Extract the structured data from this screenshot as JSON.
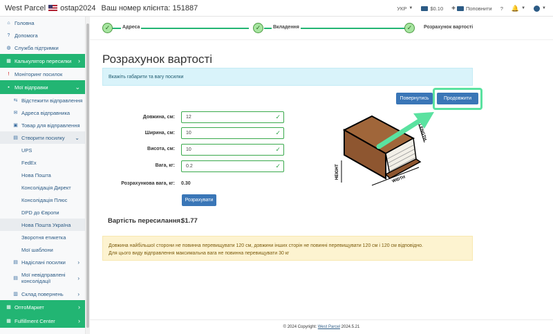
{
  "header": {
    "brand": "West Parcel",
    "username": "ostap2024",
    "client_number": "Ваш номер клієнта: 151887",
    "language": "УКР",
    "balance": "$0.10",
    "topup": "Поповнити",
    "help": "?"
  },
  "sidebar": {
    "home": "Головна",
    "help": "Допомога",
    "support": "Служба підтримки",
    "calculator": "Калькулятор пересилки",
    "monitoring": "Моніторинг посилок",
    "my_shipments": "Мої відправки",
    "track": "Відстежити відправлення",
    "sender_address": "Адреса відправника",
    "goods": "Товар для відправлення",
    "create_parcel": "Створити посилку",
    "carriers": [
      "UPS",
      "FedEx",
      "Нова Пошта",
      "Консолідація Директ",
      "Консолідація Плюс",
      "DPD до Європи",
      "Нова Пошта Україна",
      "Зворотня етикетка",
      "Мої шаблони"
    ],
    "sent": "Надіслані посилки",
    "unsent": "Мої невідправлені консолідації",
    "returns": "Склад повернень",
    "optomarket": "ОптоМаркет",
    "fulfillment": "Fulfillment Center"
  },
  "stepper": {
    "step1": "Адреса",
    "step2": "Вкладення",
    "step3": "Розрахунок вартості"
  },
  "page": {
    "title": "Розрахунок вартості",
    "info": "Вкажіть габарити та вагу посилки",
    "back_button": "Повернутись",
    "continue_button": "Продовжити",
    "length_label": "Довжина, см:",
    "length_value": "12",
    "width_label": "Ширина, см:",
    "width_value": "10",
    "height_label": "Висота, см:",
    "height_value": "10",
    "weight_label": "Вага, кг:",
    "weight_value": "0.2",
    "calc_weight_label": "Розрахункова вага, кг:",
    "calc_weight_value": "0.30",
    "calculate_button": "Розрахувати",
    "cost_label": "Вартість пересилання:",
    "cost_value": "$1.77",
    "warning_line1": "Довжина найбільшої сторони не повинна перевищувати 120 см, довжини інших сторін не повинні перевищувати 120 см і 120 см відповідно.",
    "warning_line2": "Для цього виду відправлення максимальна вага не повинна перевищувати 30 кг",
    "book_length": "LENGTH",
    "book_width": "WIDTH",
    "book_height": "HEIGHT"
  },
  "footer": {
    "prefix": "© 2024 Copyright:",
    "link": "West Parcel",
    "version": "2024.5.21"
  }
}
